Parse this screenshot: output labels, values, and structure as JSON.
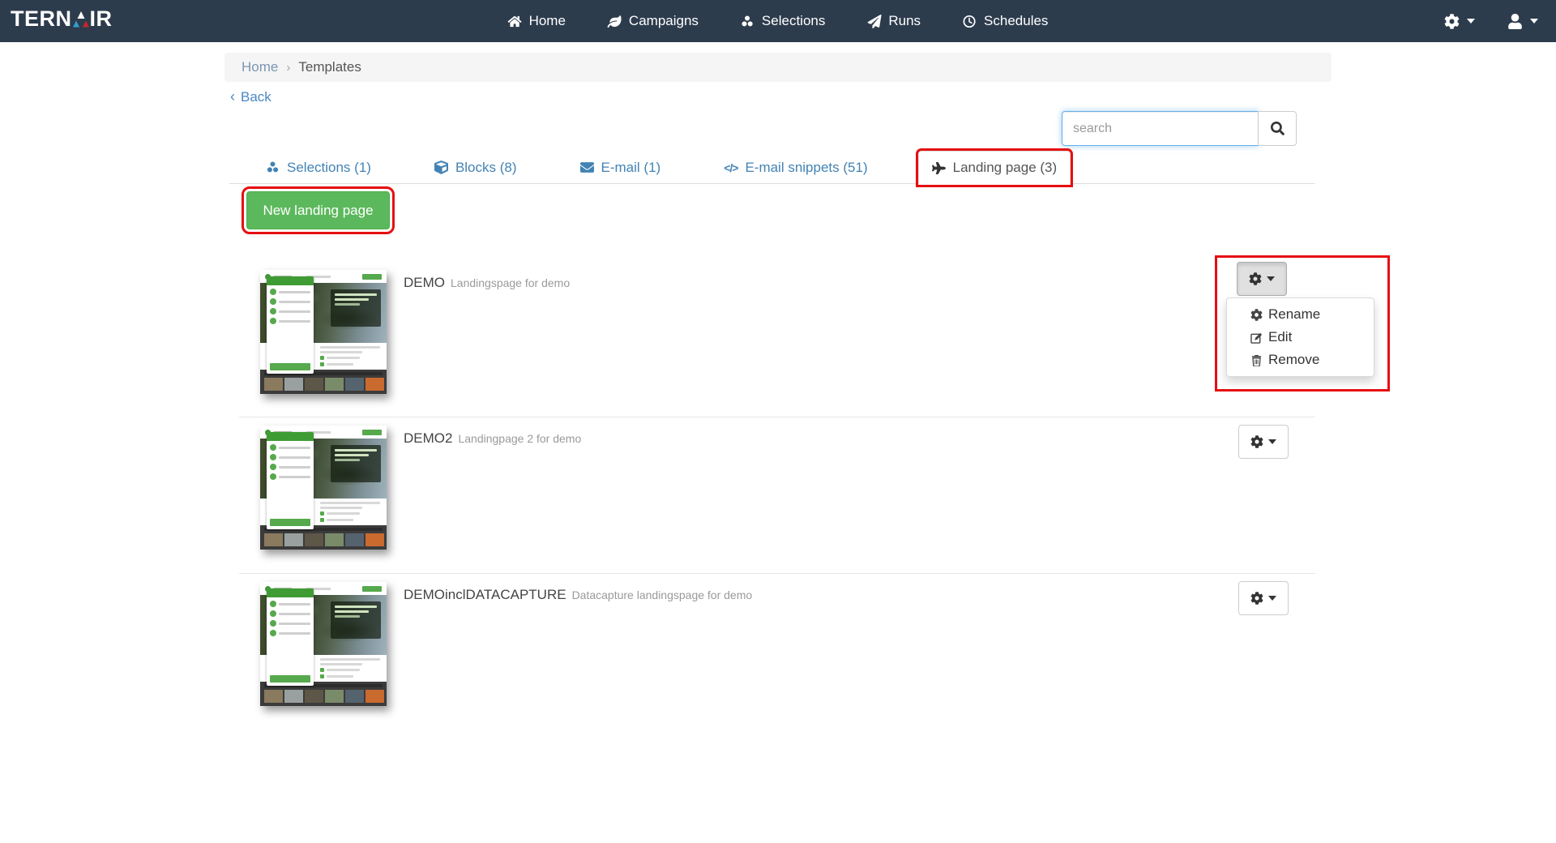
{
  "brand": {
    "prefix": "TERN",
    "suffix": "IR"
  },
  "navbar": {
    "bg_color": "#2d3c4d",
    "items": [
      {
        "label": "Home",
        "icon": "home-icon"
      },
      {
        "label": "Campaigns",
        "icon": "leaf-icon"
      },
      {
        "label": "Selections",
        "icon": "circles-icon"
      },
      {
        "label": "Runs",
        "icon": "paper-plane-icon"
      },
      {
        "label": "Schedules",
        "icon": "clock-icon"
      }
    ]
  },
  "breadcrumb": {
    "items": [
      "Home",
      "Templates"
    ],
    "separator": "›"
  },
  "back": {
    "label": "Back",
    "chevron": "‹"
  },
  "search": {
    "placeholder": "search"
  },
  "tabs": [
    {
      "label": "Selections (1)",
      "icon": "circles-icon",
      "active": false
    },
    {
      "label": "Blocks (8)",
      "icon": "cube-icon",
      "active": false
    },
    {
      "label": "E-mail (1)",
      "icon": "envelope-icon",
      "active": false
    },
    {
      "label": "E-mail snippets (51)",
      "icon": "code-icon",
      "icon_text": "</>",
      "active": false
    },
    {
      "label": "Landing page (3)",
      "icon": "plane-icon",
      "active": true
    }
  ],
  "actions": {
    "new_landing_page": "New landing page"
  },
  "templates": [
    {
      "name": "DEMO",
      "description": "Landingspage for demo",
      "menu_open": true
    },
    {
      "name": "DEMO2",
      "description": "Landingpage 2 for demo",
      "menu_open": false
    },
    {
      "name": "DEMOinclDATACAPTURE",
      "description": "Datacapture landingspage for demo",
      "menu_open": false
    }
  ],
  "context_menu": {
    "items": [
      {
        "label": "Rename",
        "icon": "gear-icon"
      },
      {
        "label": "Edit",
        "icon": "edit-icon"
      },
      {
        "label": "Remove",
        "icon": "trash-icon"
      }
    ]
  },
  "colors": {
    "navbar_bg": "#2d3c4d",
    "primary_button_green": "#5cb85c",
    "annotation_red": "#e60f0f",
    "tab_link_blue": "#4383b4",
    "search_focus_blue": "#66afe9"
  }
}
